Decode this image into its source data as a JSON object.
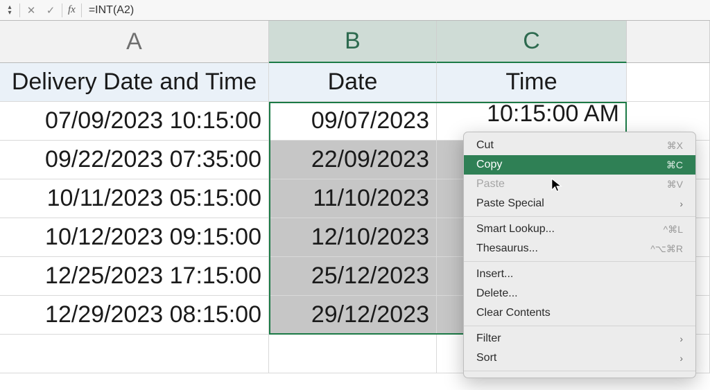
{
  "formula_bar": {
    "formula": "=INT(A2)",
    "stepper_up_glyph": "▴",
    "stepper_down_glyph": "▾",
    "cancel_glyph": "✕",
    "confirm_glyph": "✓",
    "fx_label": "fx"
  },
  "column_headers": {
    "A": "A",
    "B": "B",
    "C": "C"
  },
  "header_row": {
    "A": "Delivery Date and Time",
    "B": "Date",
    "C": "Time"
  },
  "rows": [
    {
      "A": "07/09/2023 10:15:00",
      "B": "09/07/2023",
      "C": "10:15:00 AM"
    },
    {
      "A": "09/22/2023 07:35:00",
      "B": "22/09/2023",
      "C": ""
    },
    {
      "A": "10/11/2023 05:15:00",
      "B": "11/10/2023",
      "C": ""
    },
    {
      "A": "10/12/2023 09:15:00",
      "B": "12/10/2023",
      "C": ""
    },
    {
      "A": "12/25/2023 17:15:00",
      "B": "25/12/2023",
      "C": ""
    },
    {
      "A": "12/29/2023 08:15:00",
      "B": "29/12/2023",
      "C": ""
    }
  ],
  "context_menu": {
    "items": [
      {
        "label": "Cut",
        "shortcut": "⌘X",
        "disabled": false
      },
      {
        "label": "Copy",
        "shortcut": "⌘C",
        "disabled": false,
        "hover": true
      },
      {
        "label": "Paste",
        "shortcut": "⌘V",
        "disabled": true
      },
      {
        "label": "Paste Special",
        "disabled": false,
        "submenu": true
      },
      {
        "sep": true
      },
      {
        "label": "Smart Lookup...",
        "shortcut": "^⌘L",
        "disabled": false,
        "shortcut_disabled": true
      },
      {
        "label": "Thesaurus...",
        "shortcut": "^⌥⌘R",
        "disabled": false,
        "shortcut_disabled": true
      },
      {
        "sep": true
      },
      {
        "label": "Insert...",
        "disabled": false
      },
      {
        "label": "Delete...",
        "disabled": false
      },
      {
        "label": "Clear Contents",
        "disabled": false
      },
      {
        "sep": true
      },
      {
        "label": "Filter",
        "disabled": false,
        "submenu": true
      },
      {
        "label": "Sort",
        "disabled": false,
        "submenu": true
      },
      {
        "sep": true
      }
    ]
  },
  "colors": {
    "selection_green": "#1b7a46",
    "menu_hover": "#2f8055"
  }
}
